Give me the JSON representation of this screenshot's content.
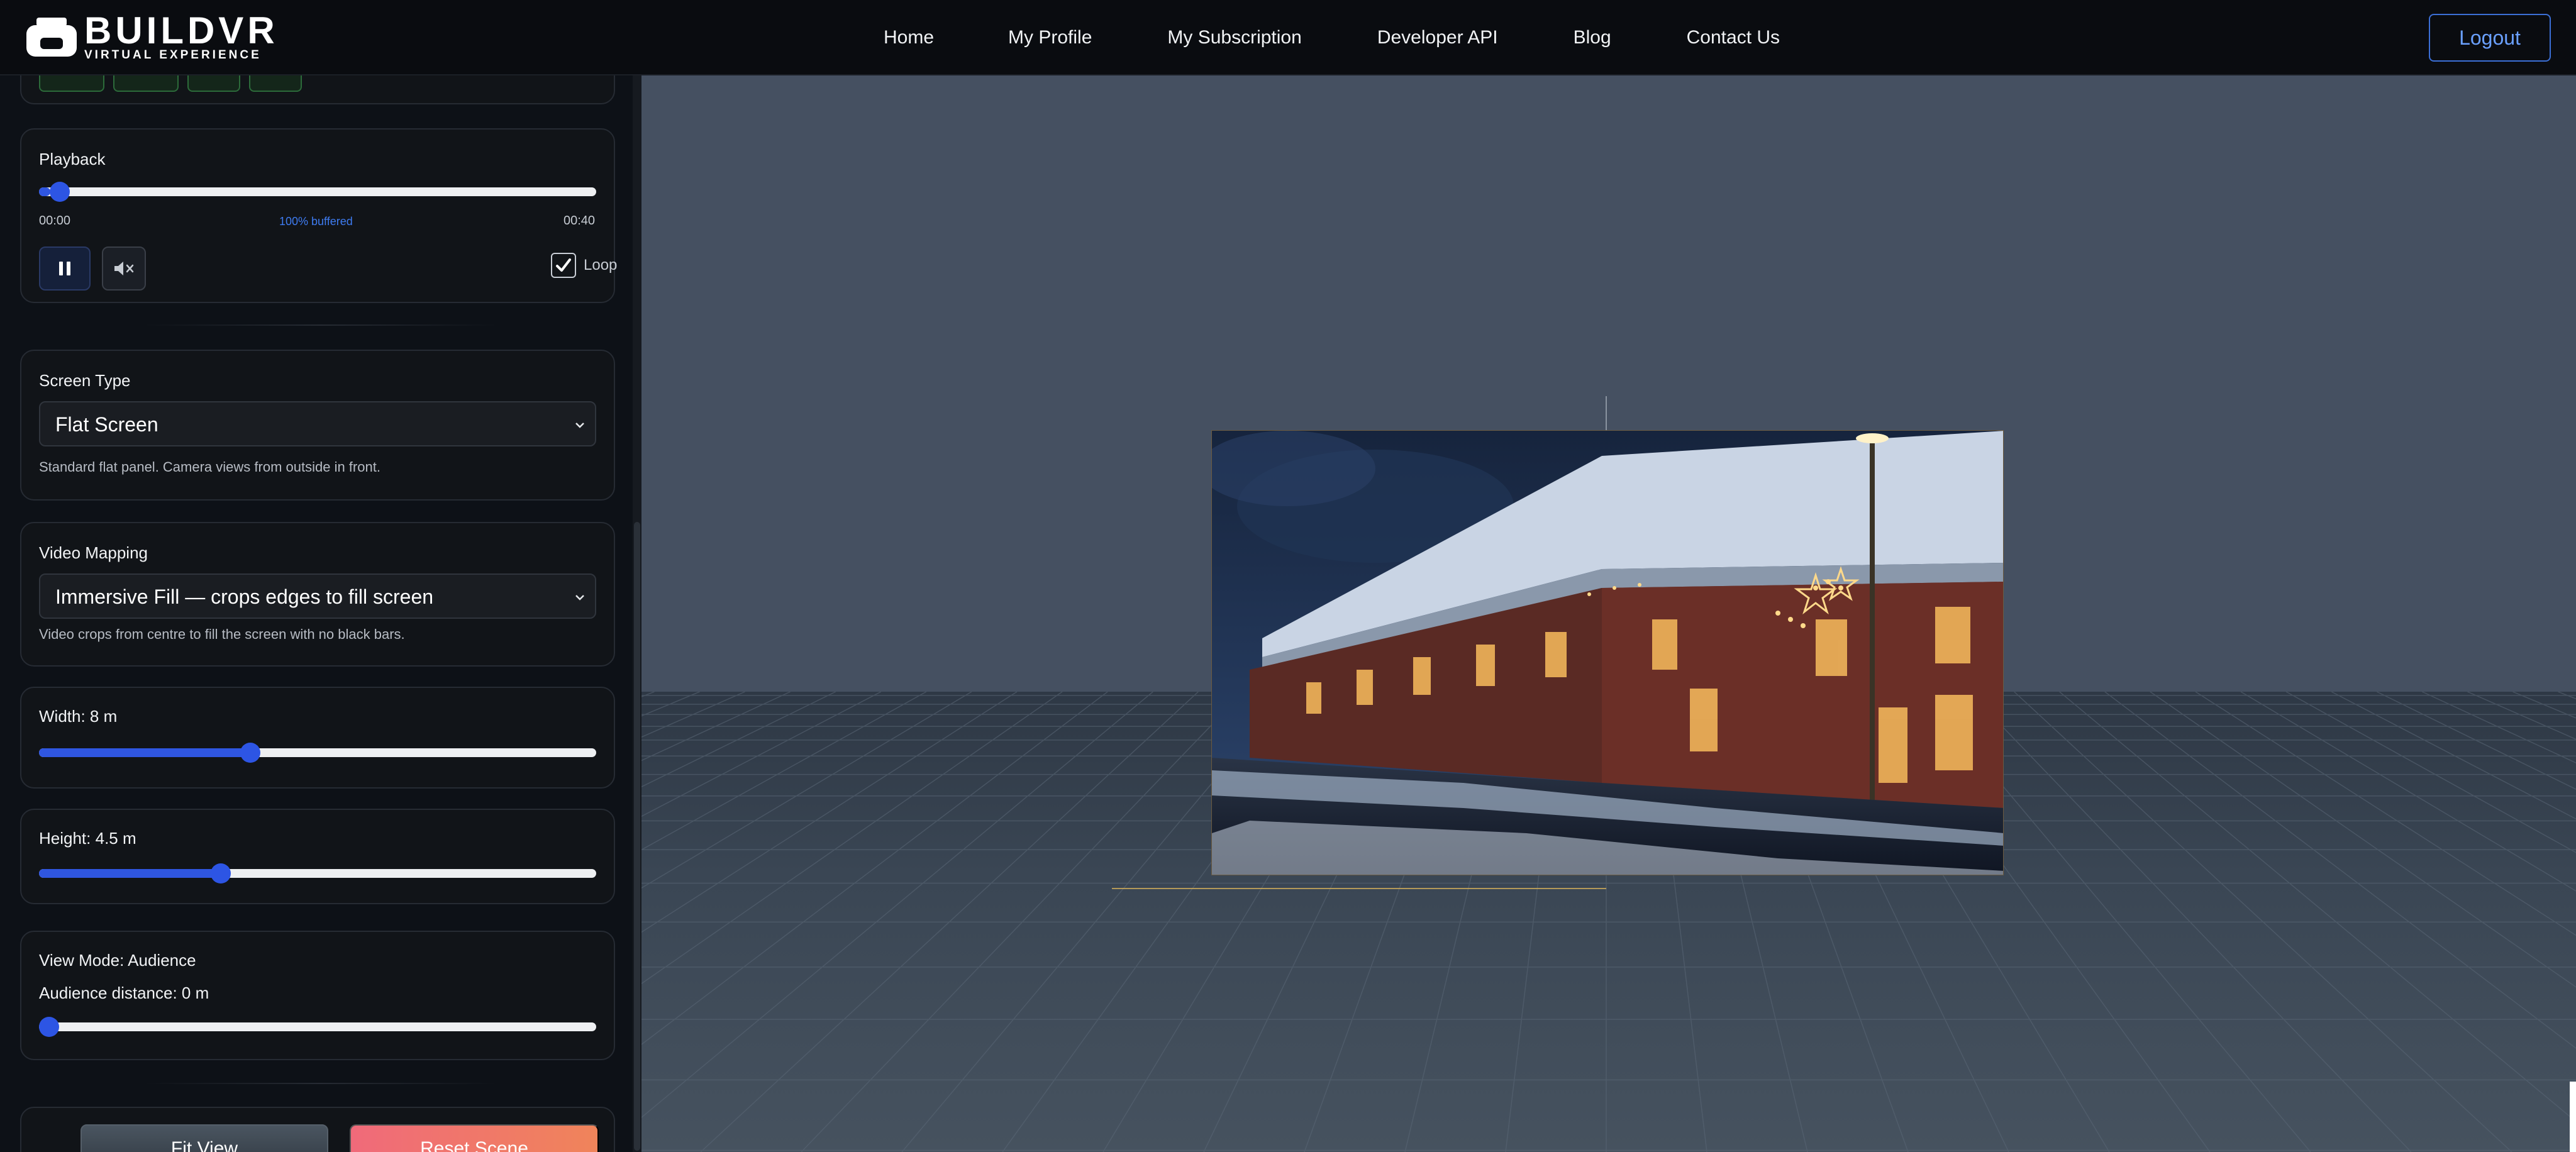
{
  "header": {
    "logo_title": "BUILDVR",
    "logo_subtitle": "VIRTUAL EXPERIENCE",
    "nav": [
      "Home",
      "My Profile",
      "My Subscription",
      "Developer API",
      "Blog",
      "Contact Us"
    ],
    "logout_label": "Logout"
  },
  "sidebar": {
    "playback": {
      "label": "Playback",
      "progress": 0.02,
      "current_time": "00:00",
      "duration": "00:40",
      "buffered": "100% buffered",
      "loop_label": "Loop",
      "loop_checked": true
    },
    "screen_type": {
      "label": "Screen Type",
      "value": "Flat Screen",
      "help": "Standard flat panel. Camera views from outside in front."
    },
    "video_mapping": {
      "label": "Video Mapping",
      "value": "Immersive Fill — crops edges to fill screen",
      "help": "Video crops from centre to fill the screen with no black bars."
    },
    "width": {
      "label": "Width: 8 m",
      "fraction": 0.375
    },
    "height": {
      "label": "Height: 4.5 m",
      "fraction": 0.32
    },
    "view_mode": {
      "label": "View Mode: Audience",
      "distance_label": "Audience distance: 0 m",
      "fraction": 0.0
    },
    "buttons": {
      "fit_view": "Fit View",
      "reset_scene": "Reset Scene"
    }
  },
  "colors": {
    "accent": "#2d55e4",
    "logout_border": "#3b6fd6",
    "reset_gradient_start": "#f06a7a",
    "reset_gradient_end": "#f0845a",
    "viewport_bg": "#445060"
  }
}
